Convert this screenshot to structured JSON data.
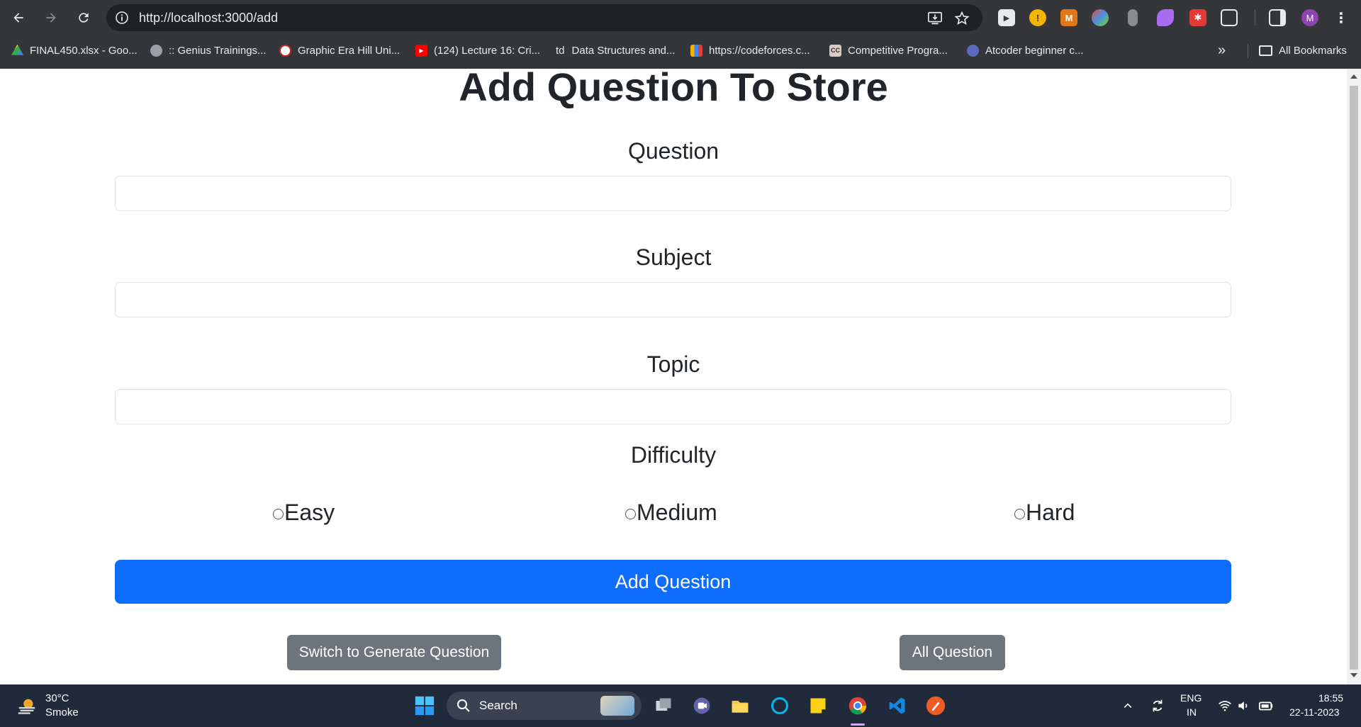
{
  "browser": {
    "url": "http://localhost:3000/add",
    "avatar_letter": "M",
    "bookmarks": [
      "FINAL450.xlsx - Goo...",
      ":: Genius Trainings...",
      "Graphic Era Hill Uni...",
      "(124) Lecture 16: Cri...",
      "Data Structures and...",
      "https://codeforces.c...",
      "Competitive Progra...",
      "Atcoder beginner c..."
    ],
    "bookmark_prefix_td": "td",
    "all_bookmarks_label": "All Bookmarks",
    "more_glyph": "»"
  },
  "page": {
    "title": "Add Question To Store",
    "fields": {
      "question_label": "Question",
      "subject_label": "Subject",
      "topic_label": "Topic",
      "difficulty_label": "Difficulty"
    },
    "inputs": {
      "question_value": "",
      "subject_value": "",
      "topic_value": ""
    },
    "difficulty_options": [
      "Easy",
      "Medium",
      "Hard"
    ],
    "add_button_label": "Add Question",
    "switch_button_label": "Switch to Generate Question",
    "all_button_label": "All Question",
    "colors": {
      "primary": "#0d6efd",
      "secondary": "#6c757d"
    }
  },
  "taskbar": {
    "weather_temp": "30°C",
    "weather_desc": "Smoke",
    "search_label": "Search",
    "lang_line1": "ENG",
    "lang_line2": "IN",
    "time": "18:55",
    "date": "22-11-2023"
  }
}
